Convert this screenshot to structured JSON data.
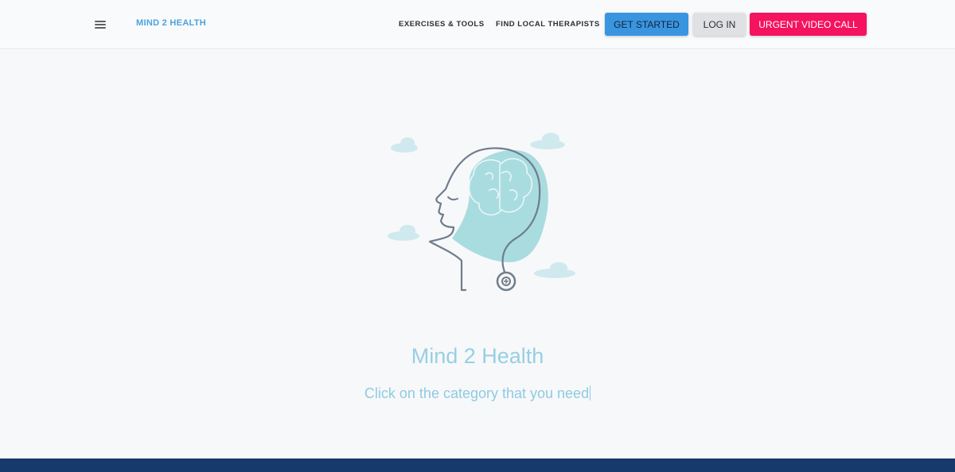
{
  "header": {
    "brand": "MIND 2 HEALTH",
    "menu_icon": "hamburger-menu-icon",
    "nav": {
      "exercises_tools": "EXERCISES & TOOLS",
      "find_therapists": "FIND LOCAL THERAPISTS"
    },
    "buttons": {
      "get_started": "GET STARTED",
      "log_in": "LOG IN",
      "urgent_video_call": "URGENT VIDEO CALL"
    }
  },
  "hero": {
    "illustration_icon": "head-brain-stethoscope-icon",
    "title": "Mind 2 Health",
    "subtitle": "Click on the category that you need"
  },
  "colors": {
    "brand": "#4aa3df",
    "get_started_bg": "#3a95e0",
    "urgent_bg": "#f5125e",
    "login_bg": "#dfe1e4",
    "hero_text": "#97cfe3",
    "footer": "#163a6b",
    "illustration_teal": "#a9dcdf"
  }
}
